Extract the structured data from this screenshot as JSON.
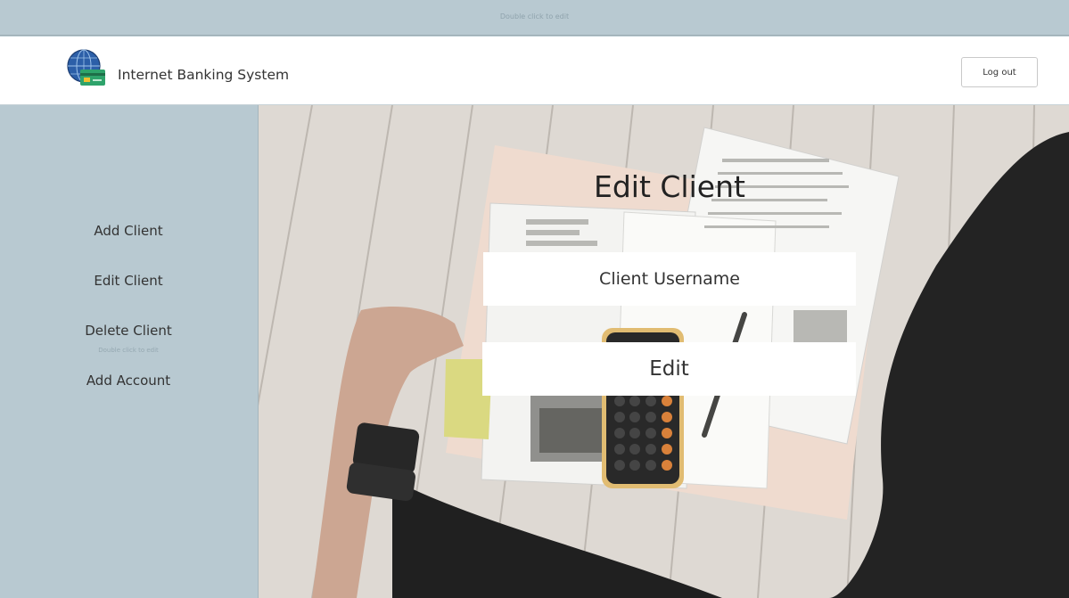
{
  "top_strip": {
    "hint": "Double click to edit"
  },
  "header": {
    "app_title": "Internet Banking System",
    "logout_label": "Log out"
  },
  "sidebar": {
    "items": [
      {
        "label": "Add Client"
      },
      {
        "label": "Edit Client"
      },
      {
        "label": "Delete Client"
      },
      {
        "label": "Add Account"
      }
    ],
    "hint": "Double click to edit"
  },
  "main": {
    "title": "Edit Client",
    "username_placeholder": "Client Username",
    "username_value": "",
    "edit_label": "Edit"
  },
  "colors": {
    "strip": "#b8c9d1",
    "sidebar": "#b8c9d1",
    "header": "#ffffff",
    "field": "#ffffff"
  }
}
